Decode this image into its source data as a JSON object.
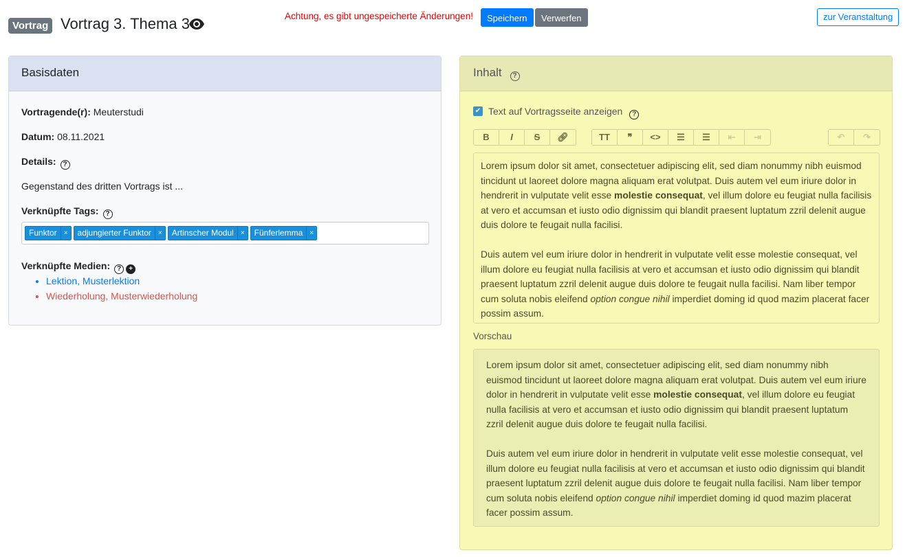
{
  "header": {
    "badge": "Vortrag",
    "title": "Vortrag 3. Thema 3",
    "warning": "Achtung, es gibt ungespeicherte Änderungen!",
    "save": "Speichern",
    "discard": "Verwerfen",
    "event": "zur Veranstaltung"
  },
  "basis": {
    "title": "Basisdaten",
    "speaker_label": "Vortragende(r):",
    "speaker": "Meuterstudi",
    "date_label": "Datum:",
    "date": "08.11.2021",
    "details_label": "Details:",
    "details": "Gegenstand des dritten Vortrags ist ...",
    "tags_label": "Verknüpfte Tags:",
    "tags": [
      "Funktor",
      "adjungierter Funktor",
      "Artinscher Modul",
      "Fünferlemma"
    ],
    "media_label": "Verknüpfte Medien:",
    "media": [
      "Lektion, Musterlektion",
      "Wiederholung, Musterwiederholung"
    ]
  },
  "content": {
    "title": "Inhalt",
    "show_label": "Text auf Vortragsseite anzeigen",
    "preview_label": "Vorschau",
    "p1a": "Lorem ipsum dolor sit amet, consectetuer adipiscing elit, sed diam nonummy nibh euismod tincidunt ut laoreet dolore magna aliquam erat volutpat. Duis autem vel eum iriure dolor in hendrerit in vulputate velit esse ",
    "p1b": "molestie consequat",
    "p1c": ", vel illum dolore eu feugiat nulla facilisis at vero et accumsan et iusto odio dignissim qui blandit praesent luptatum zzril delenit augue duis dolore te feugait nulla facilisi.",
    "p2a": "Duis autem vel eum iriure dolor in hendrerit in vulputate velit esse molestie consequat, vel illum dolore eu feugiat nulla facilisis at vero et accumsan et iusto odio dignissim qui blandit praesent luptatum zzril delenit augue duis dolore te feugait nulla facilisi. Nam liber tempor cum soluta nobis eleifend ",
    "p2b": "option congue nihil",
    "p2c": " imperdiet doming id quod mazim placerat facer possim assum."
  }
}
